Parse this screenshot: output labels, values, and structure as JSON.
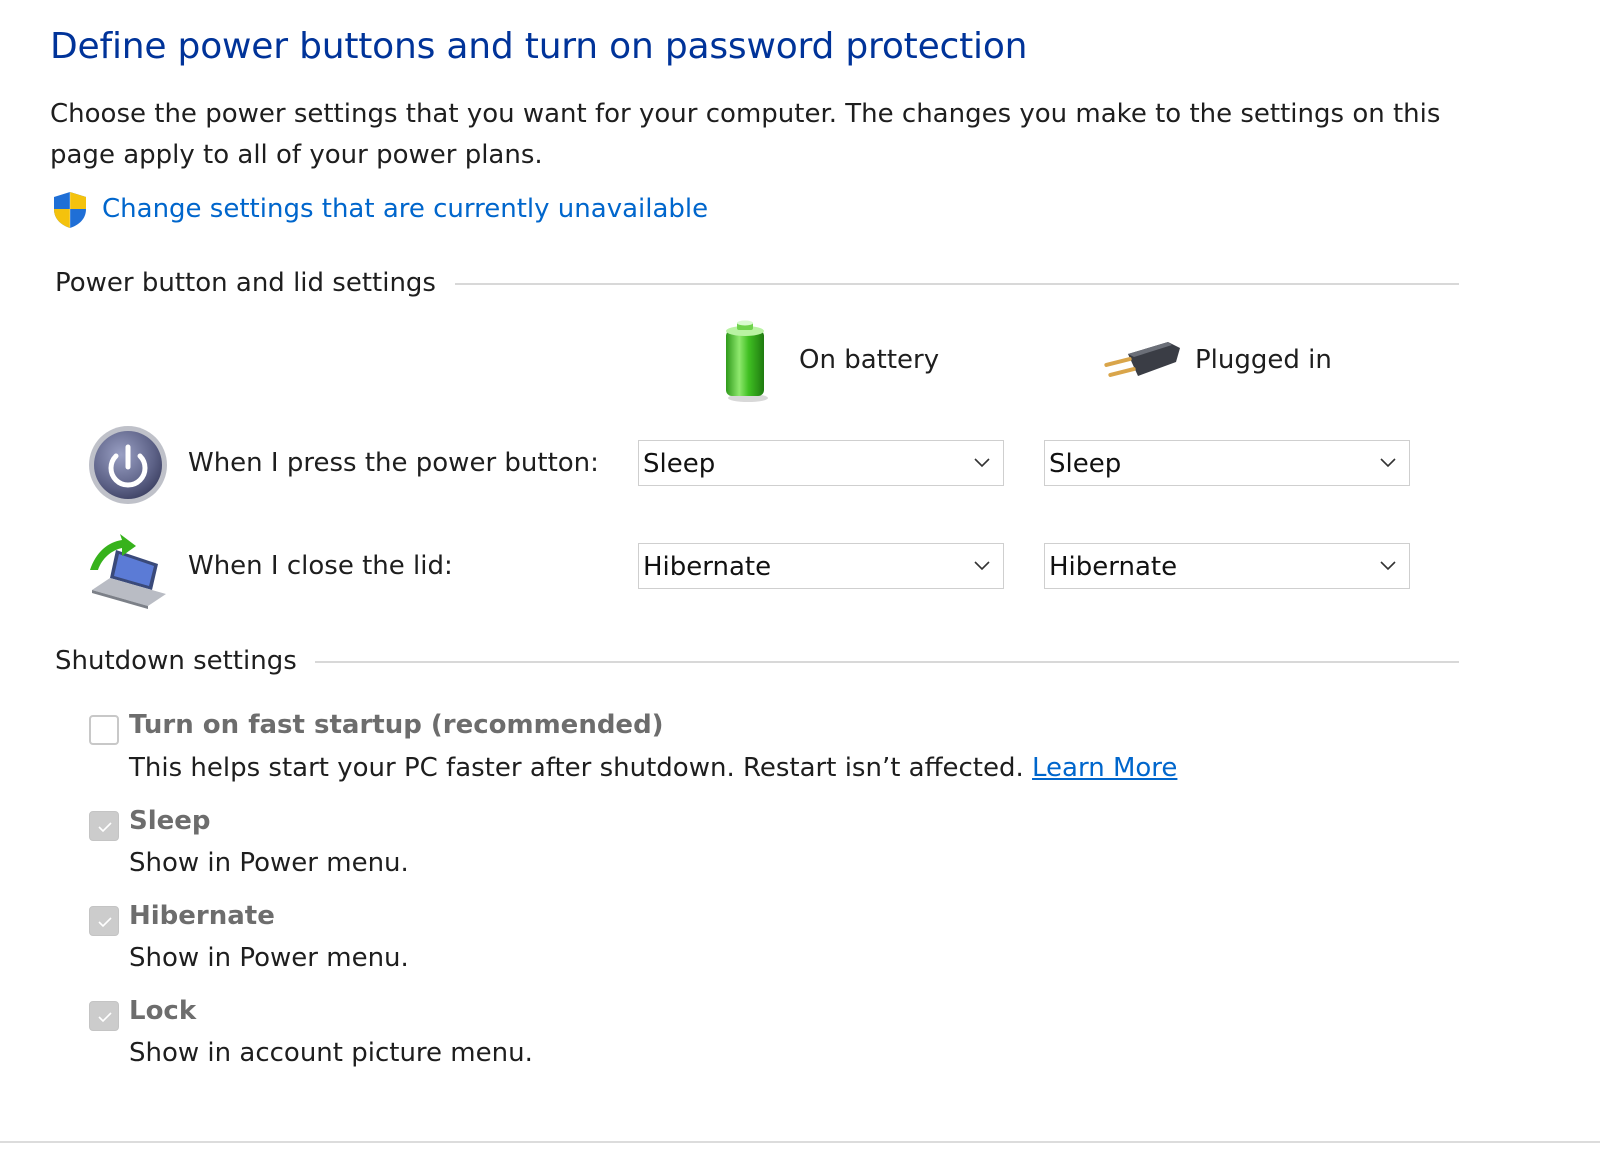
{
  "page": {
    "title": "Define power buttons and turn on password protection",
    "description": "Choose the power settings that you want for your computer. The changes you make to the settings on this page apply to all of your power plans.",
    "change_settings_link": "Change settings that are currently unavailable",
    "icons": {
      "shield": "uac-shield-icon",
      "battery": "battery-icon",
      "plug": "power-plug-icon",
      "power_button": "power-button-icon",
      "lid": "laptop-lid-icon"
    },
    "colors": {
      "title": "#003399",
      "link": "#0066cc",
      "disabled_text": "#6d6d6d"
    }
  },
  "power_group": {
    "title": "Power button and lid settings",
    "columns": {
      "on_battery": "On battery",
      "plugged_in": "Plugged in"
    },
    "rows": [
      {
        "label": "When I press the power button:",
        "on_battery": "Sleep",
        "plugged_in": "Sleep"
      },
      {
        "label": "When I close the lid:",
        "on_battery": "Hibernate",
        "plugged_in": "Hibernate"
      }
    ]
  },
  "shutdown_group": {
    "title": "Shutdown settings",
    "options": [
      {
        "label": "Turn on fast startup (recommended)",
        "description": "This helps start your PC faster after shutdown. Restart isn’t affected.",
        "link": "Learn More",
        "checked": false,
        "disabled": true
      },
      {
        "label": "Sleep",
        "description": "Show in Power menu.",
        "checked": true,
        "disabled": true
      },
      {
        "label": "Hibernate",
        "description": "Show in Power menu.",
        "checked": true,
        "disabled": true
      },
      {
        "label": "Lock",
        "description": "Show in account picture menu.",
        "checked": true,
        "disabled": true
      }
    ]
  }
}
